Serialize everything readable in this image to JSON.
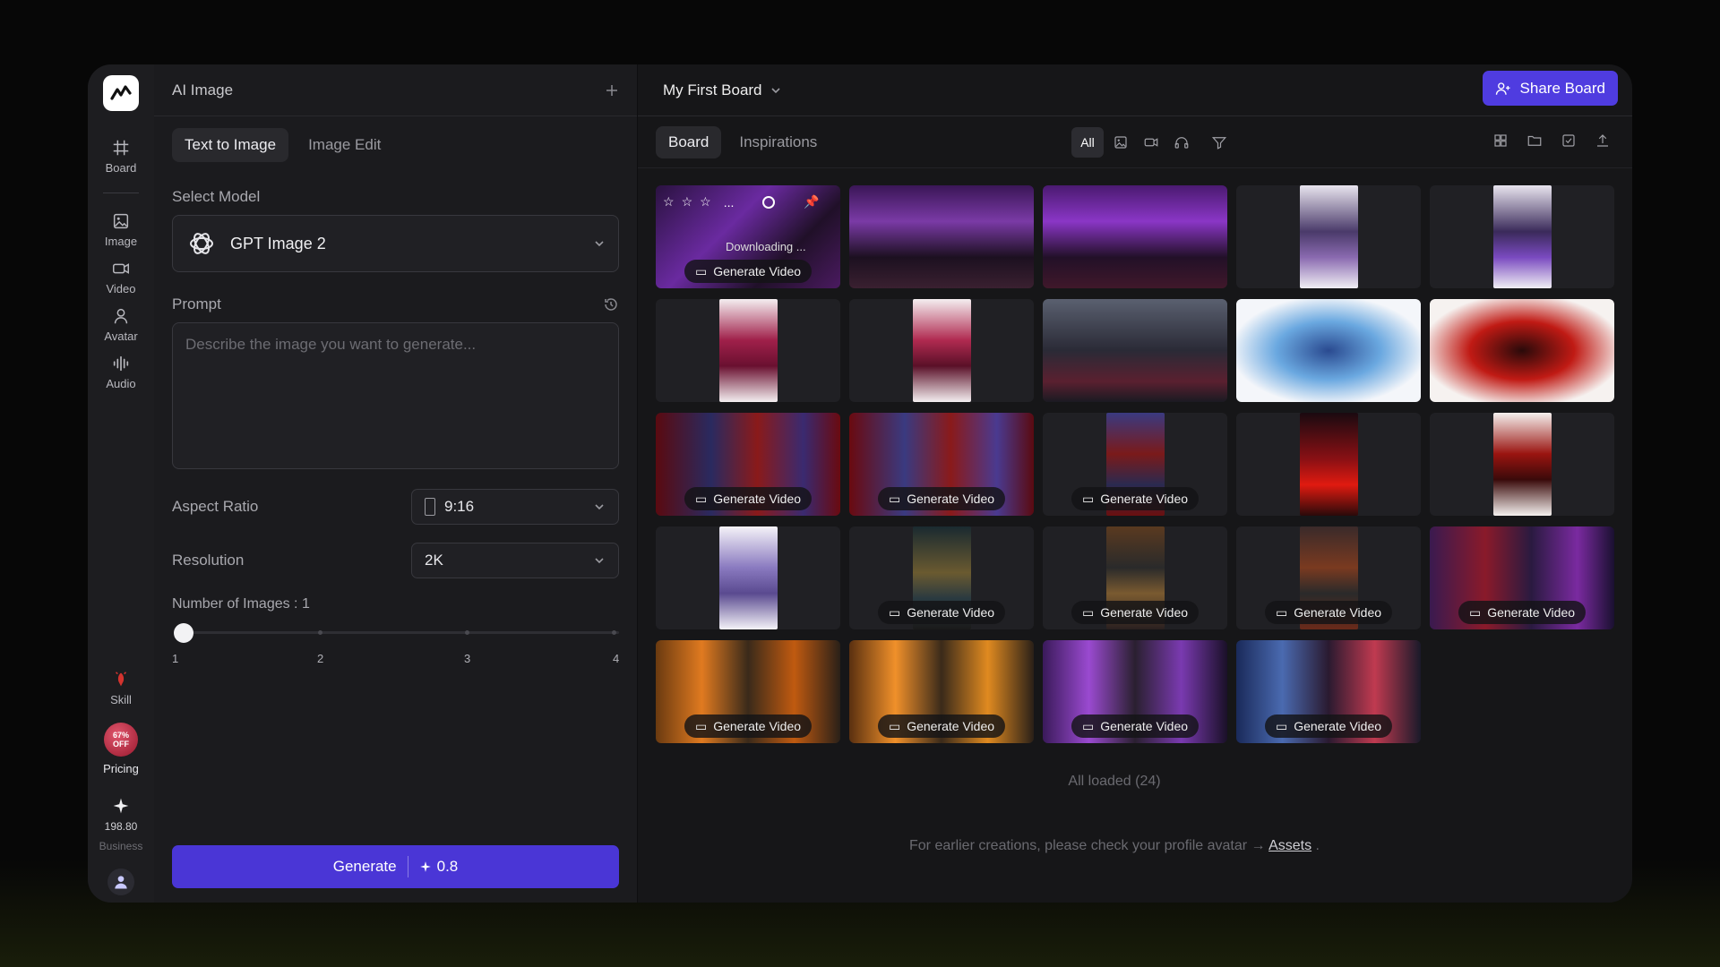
{
  "rail": {
    "items": [
      {
        "label": "Board",
        "icon": "hash-icon"
      },
      {
        "label": "Image",
        "icon": "image-icon"
      },
      {
        "label": "Video",
        "icon": "video-icon"
      },
      {
        "label": "Avatar",
        "icon": "person-icon"
      },
      {
        "label": "Audio",
        "icon": "waveform-icon"
      }
    ],
    "skill_label": "Skill",
    "promo_line1": "67%",
    "promo_line2": "OFF",
    "pricing_label": "Pricing",
    "credits": "198.80",
    "plan": "Business"
  },
  "panel": {
    "title": "AI Image",
    "tabs": [
      "Text to Image",
      "Image Edit"
    ],
    "select_model_label": "Select Model",
    "model_name": "GPT Image 2",
    "prompt_label": "Prompt",
    "prompt_placeholder": "Describe the image you want to generate...",
    "aspect_label": "Aspect Ratio",
    "aspect_value": "9:16",
    "resolution_label": "Resolution",
    "resolution_value": "2K",
    "num_images_label": "Number of Images : 1",
    "slider_ticks": [
      "1",
      "2",
      "3",
      "4"
    ],
    "slider_value": 1,
    "generate_label": "Generate",
    "generate_cost": "0.8"
  },
  "board": {
    "title": "My First Board",
    "share_label": "Share Board",
    "tabs": [
      "Board",
      "Inspirations"
    ],
    "filter_all": "All",
    "generate_video_label": "Generate Video",
    "downloading_label": "Downloading ...",
    "hover_more": "...",
    "status": "All loaded  (24)",
    "note_text": "For earlier creations, please check your profile avatar →",
    "note_link": "Assets",
    "note_end": "."
  },
  "colors": {
    "accent": "#4f3ce0",
    "generate": "#4a36d6"
  }
}
